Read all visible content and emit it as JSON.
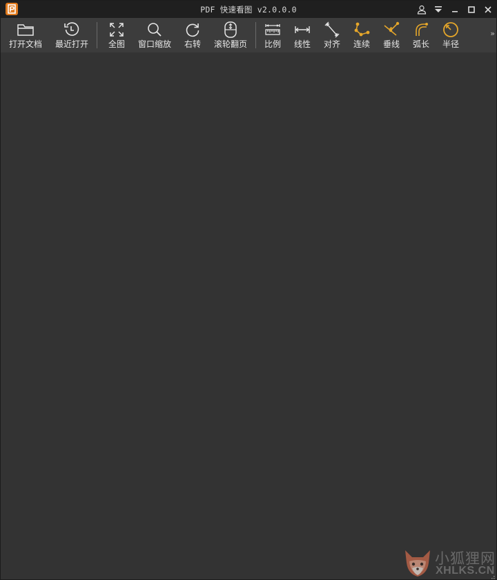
{
  "window": {
    "title": "PDF 快速看图 v2.0.0.0",
    "logo_letter": "P",
    "accent_color": "#e07a1e",
    "measure_icon_color": "#e6a72a",
    "controls": [
      "user-icon",
      "dropdown-icon",
      "minimize-icon",
      "maximize-icon",
      "close-icon"
    ]
  },
  "toolbar": {
    "items": [
      {
        "label": "打开文档",
        "icon": "folder-icon"
      },
      {
        "label": "最近打开",
        "icon": "history-icon"
      },
      {
        "label": "全图",
        "icon": "fit-all-icon"
      },
      {
        "label": "窗口缩放",
        "icon": "zoom-icon"
      },
      {
        "label": "右转",
        "icon": "rotate-right-icon"
      },
      {
        "label": "滚轮翻页",
        "icon": "mouse-wheel-icon"
      },
      {
        "label": "比例",
        "icon": "ruler-scale-icon"
      },
      {
        "label": "线性",
        "icon": "linear-measure-icon"
      },
      {
        "label": "对齐",
        "icon": "aligned-measure-icon"
      },
      {
        "label": "连续",
        "icon": "continuous-measure-icon"
      },
      {
        "label": "垂线",
        "icon": "perpendicular-icon"
      },
      {
        "label": "弧长",
        "icon": "arc-length-icon"
      },
      {
        "label": "半径",
        "icon": "radius-icon"
      }
    ],
    "overflow": "»"
  },
  "watermark": {
    "cn": "小狐狸网",
    "en": "XHLKS.CN"
  }
}
